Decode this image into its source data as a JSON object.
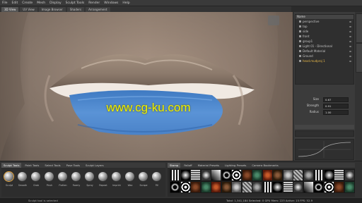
{
  "menubar": {
    "items": [
      "File",
      "Edit",
      "Create",
      "Mesh",
      "Display",
      "Sculpt Tools",
      "Render",
      "Windows",
      "Help"
    ]
  },
  "tabs": [
    "3D View",
    "UV View",
    "Image Browser",
    "Shaders",
    "Arrangement"
  ],
  "watermark": "www.cg-ku.com",
  "outliner": {
    "header": "Name",
    "rows": [
      {
        "label": "perspective",
        "selected": false
      },
      {
        "label": "top",
        "selected": false
      },
      {
        "label": "side",
        "selected": false
      },
      {
        "label": "front",
        "selected": false
      },
      {
        "label": "group1",
        "selected": false
      },
      {
        "label": "Light 01 - Directional",
        "selected": false
      },
      {
        "label": "Default Material",
        "selected": false
      },
      {
        "label": "Ground",
        "selected": false
      },
      {
        "label": "head.mudproj 1",
        "selected": true
      }
    ]
  },
  "properties": [
    {
      "label": "Size",
      "value": "0.67"
    },
    {
      "label": "Strength",
      "value": "0.91"
    },
    {
      "label": "Radius",
      "value": "1.00"
    }
  ],
  "tools_tabs": [
    "Sculpt Tools",
    "Paint Tools",
    "Select Tools",
    "Pose Tools",
    "Sculpt Layers"
  ],
  "brushes": [
    "Sculpt",
    "Smooth",
    "Grab",
    "Pinch",
    "Flatten",
    "Foamy",
    "Spray",
    "Repeat",
    "Imprint",
    "Wax",
    "Scrape",
    "Fill"
  ],
  "stamps_tabs": [
    "Stamp",
    "Falloff",
    "Material Presets",
    "Lighting Presets",
    "Camera Bookmarks"
  ],
  "status": {
    "left": "Sculpt tool is selected",
    "right": "Total: 1,341,184  Selected: 0  GPU Mem: 223  Active: 15   FPS: 52.9"
  },
  "colors": {
    "lip_paint": "#5a93d6",
    "watermark": "#f1f000",
    "selection": "#e8a63b"
  }
}
